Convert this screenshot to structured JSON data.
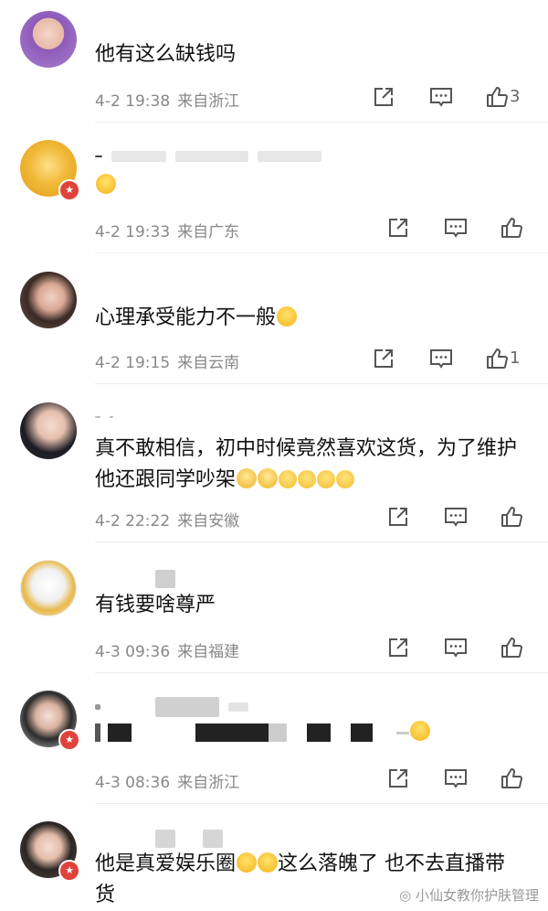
{
  "comments": [
    {
      "text": "他有这么缺钱吗",
      "time": "4-2 19:38",
      "location": "来自浙江",
      "likes": "3"
    },
    {
      "text": "",
      "time": "4-2 19:33",
      "location": "来自广东",
      "likes": ""
    },
    {
      "text": "心理承受能力不一般",
      "time": "4-2 19:15",
      "location": "来自云南",
      "likes": "1"
    },
    {
      "text": "真不敢相信，初中时候竟然喜欢这货，为了维护他还跟同学吵架",
      "time": "4-2 22:22",
      "location": "来自安徽",
      "likes": ""
    },
    {
      "text": "有钱要啥尊严",
      "time": "4-3 09:36",
      "location": "来自福建",
      "likes": ""
    },
    {
      "text": "",
      "time": "4-3 08:36",
      "location": "来自浙江",
      "likes": ""
    },
    {
      "text_part1": "他是真爱娱乐圈",
      "text_part2": "这么落魄了 也不去直播带货"
    }
  ],
  "icons": {
    "share": "share-icon",
    "reply": "comment-icon",
    "like": "thumbs-up-icon",
    "vip": "vip-badge-icon"
  },
  "watermark": "小仙女教你护肤管理",
  "colors": {
    "badge": "#e0433a",
    "meta": "#888888",
    "divider": "#ececec"
  }
}
